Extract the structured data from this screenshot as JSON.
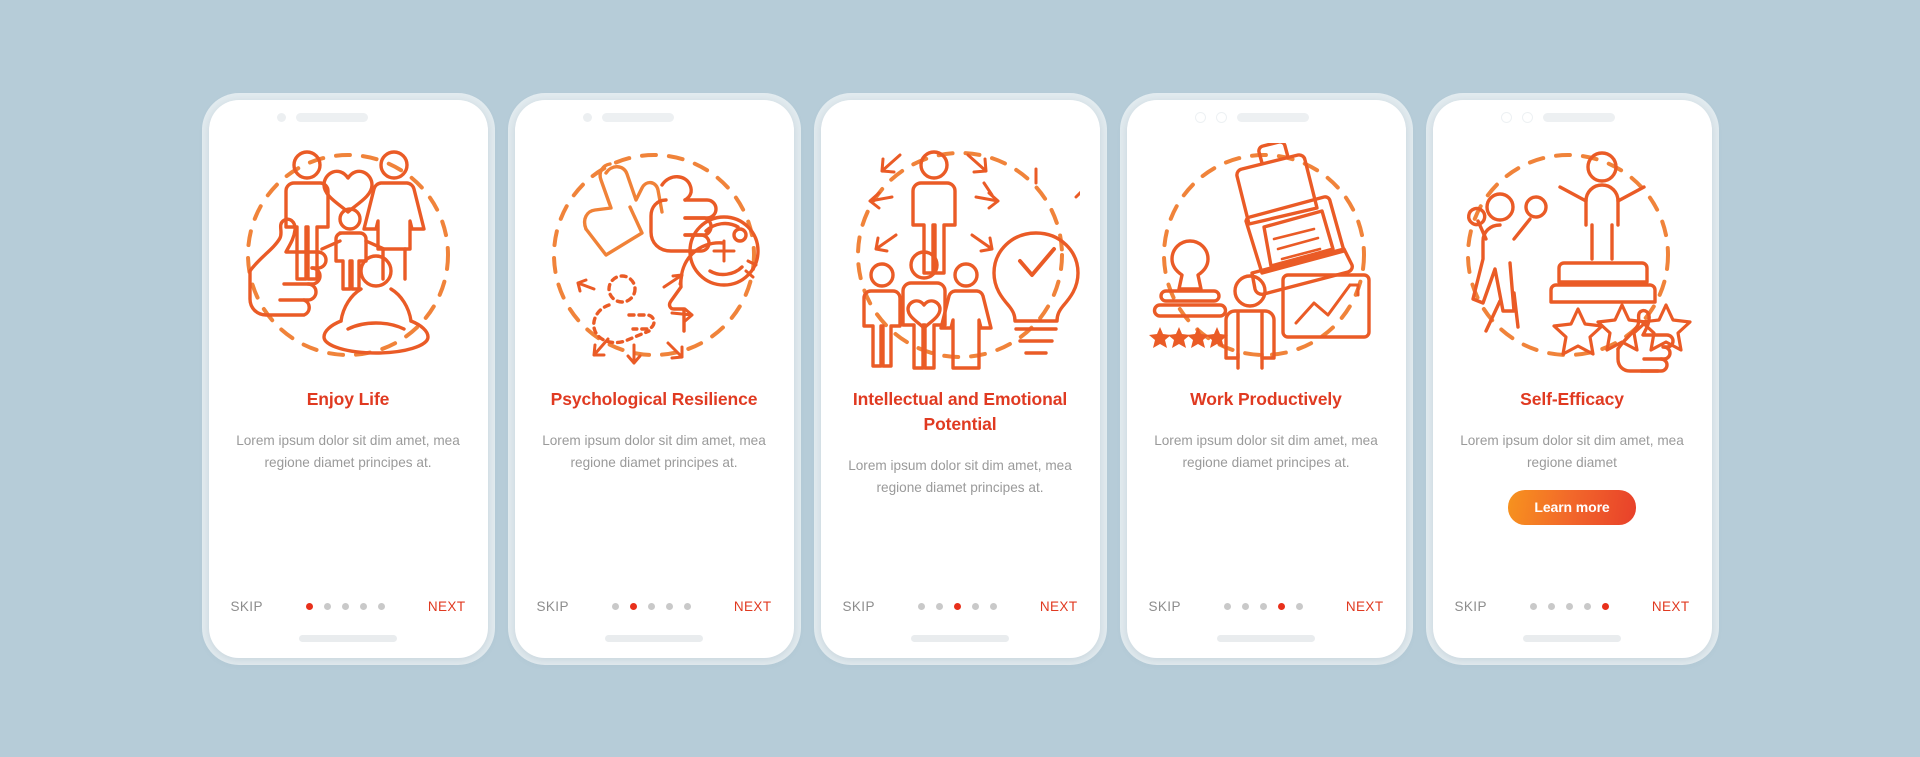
{
  "theme": {
    "background": "#b6ccd8",
    "card_background": "#ffffff",
    "accent_red": "#e03a21",
    "accent_orange": "#f7931e",
    "body_text": "#9a9a9a",
    "skip_text": "#8d8d8d",
    "dot_inactive": "#c9c9c9",
    "dot_active": "#e8301b"
  },
  "common": {
    "skip_label": "SKIP",
    "next_label": "NEXT",
    "total_dots": 5
  },
  "screens": [
    {
      "status_bar": {
        "camera_dots": 1,
        "speaker": true
      },
      "illustration": "family-thumbsup-meditation-icon",
      "title": "Enjoy Life",
      "body": "Lorem ipsum dolor sit dim amet, mea regione diamet principes at.",
      "skip_label": "SKIP",
      "next_label": "NEXT",
      "active_dot": 0,
      "learn_more": null
    },
    {
      "status_bar": {
        "camera_dots": 1,
        "speaker": true
      },
      "illustration": "hands-mind-person-resilience-icon",
      "title": "Psychological Resilience",
      "body": "Lorem ipsum dolor sit dim amet, mea regione diamet principes at.",
      "skip_label": "SKIP",
      "next_label": "NEXT",
      "active_dot": 1,
      "learn_more": null
    },
    {
      "status_bar": {
        "camera_dots": 0,
        "speaker": false
      },
      "illustration": "person-arrows-family-lightbulb-icon",
      "title": "Intellectual and Emotional Potential",
      "body": "Lorem ipsum dolor sit dim amet, mea regione diamet principes at.",
      "skip_label": "SKIP",
      "next_label": "NEXT",
      "active_dot": 2,
      "learn_more": null
    },
    {
      "status_bar": {
        "camera_dots": 2,
        "speaker": true
      },
      "illustration": "laptop-briefcase-presentation-award-icon",
      "title": "Work Productively",
      "body": "Lorem ipsum dolor sit dim amet, mea regione diamet principes at.",
      "skip_label": "SKIP",
      "next_label": "NEXT",
      "active_dot": 3,
      "learn_more": null
    },
    {
      "status_bar": {
        "camera_dots": 2,
        "speaker": true
      },
      "illustration": "winner-podium-stars-thumbsup-icon",
      "title": "Self-Efficacy",
      "body": "Lorem ipsum dolor sit dim amet, mea regione diamet",
      "skip_label": "SKIP",
      "next_label": "NEXT",
      "active_dot": 4,
      "learn_more": "Learn more"
    }
  ]
}
